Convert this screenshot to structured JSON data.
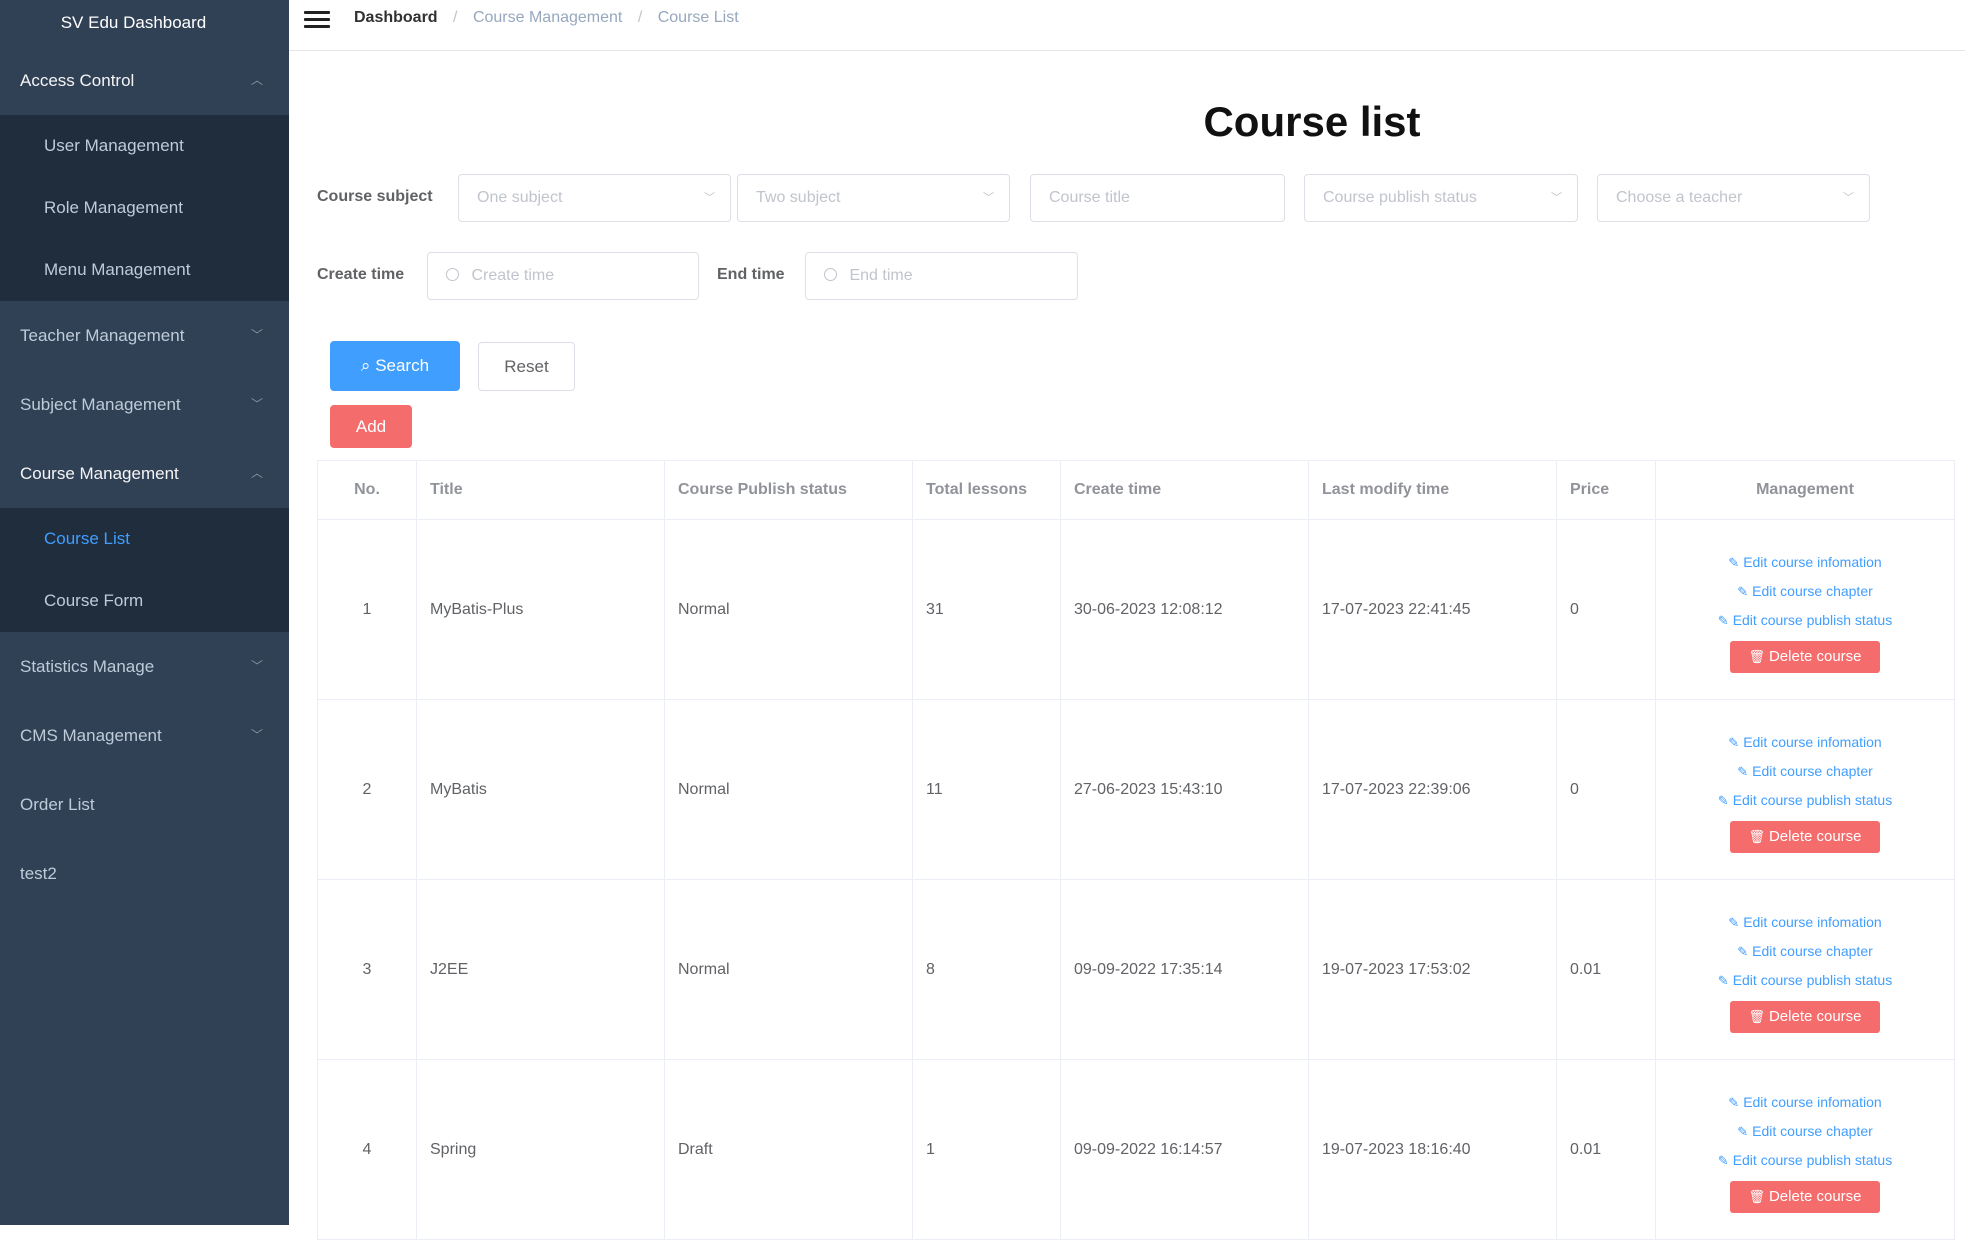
{
  "sidebar": {
    "brand": "SV Edu Dashboard",
    "menus": [
      {
        "label": "Access Control",
        "chevron": "^",
        "children": [
          "User Management",
          "Role Management",
          "Menu Management"
        ]
      },
      {
        "label": "Teacher Management",
        "chevron": "v"
      },
      {
        "label": "Subject Management",
        "chevron": "v"
      },
      {
        "label": "Course Management",
        "chevron": "^",
        "children": [
          "Course List",
          "Course Form"
        ]
      },
      {
        "label": "Statistics Manage",
        "chevron": "v"
      },
      {
        "label": "CMS Management",
        "chevron": "v"
      },
      {
        "label": "Order List"
      },
      {
        "label": "test2"
      }
    ],
    "active_item": "Course List",
    "active_color": "#409eff",
    "bg_color": "#304156"
  },
  "header": {
    "breadcrumb": [
      "Dashboard",
      "Course Management",
      "Course List"
    ]
  },
  "page": {
    "title": "Course list",
    "filters": {
      "subject_label": "Course subject",
      "one_subject_placeholder": "One subject",
      "two_subject_placeholder": "Two subject",
      "title_placeholder": "Course title",
      "status_placeholder": "Course publish status",
      "teacher_placeholder": "Choose a teacher",
      "create_label": "Create time",
      "create_placeholder": "Create time",
      "end_label": "End time",
      "end_placeholder": "End time"
    },
    "buttons": {
      "search": "Search",
      "reset": "Reset",
      "add": "Add"
    }
  },
  "table": {
    "headers": [
      "No.",
      "Title",
      "Course Publish status",
      "Total lessons",
      "Create time",
      "Last modify time",
      "Price",
      "Management"
    ],
    "rows": [
      {
        "no": "1",
        "title": "MyBatis-Plus",
        "status": "Normal",
        "lessons": "31",
        "create": "30-06-2023 12:08:12",
        "modify": "17-07-2023 22:41:45",
        "price": "0"
      },
      {
        "no": "2",
        "title": "MyBatis",
        "status": "Normal",
        "lessons": "11",
        "create": "27-06-2023 15:43:10",
        "modify": "17-07-2023 22:39:06",
        "price": "0"
      },
      {
        "no": "3",
        "title": "J2EE",
        "status": "Normal",
        "lessons": "8",
        "create": "09-09-2022 17:35:14",
        "modify": "19-07-2023 17:53:02",
        "price": "0.01"
      },
      {
        "no": "4",
        "title": "Spring",
        "status": "Draft",
        "lessons": "1",
        "create": "09-09-2022 16:14:57",
        "modify": "19-07-2023 18:16:40",
        "price": "0.01"
      }
    ],
    "actions": {
      "edit_info": "Edit course infomation",
      "edit_chapter": "Edit course chapter",
      "edit_status": "Edit course publish status",
      "delete": "Delete course"
    }
  }
}
